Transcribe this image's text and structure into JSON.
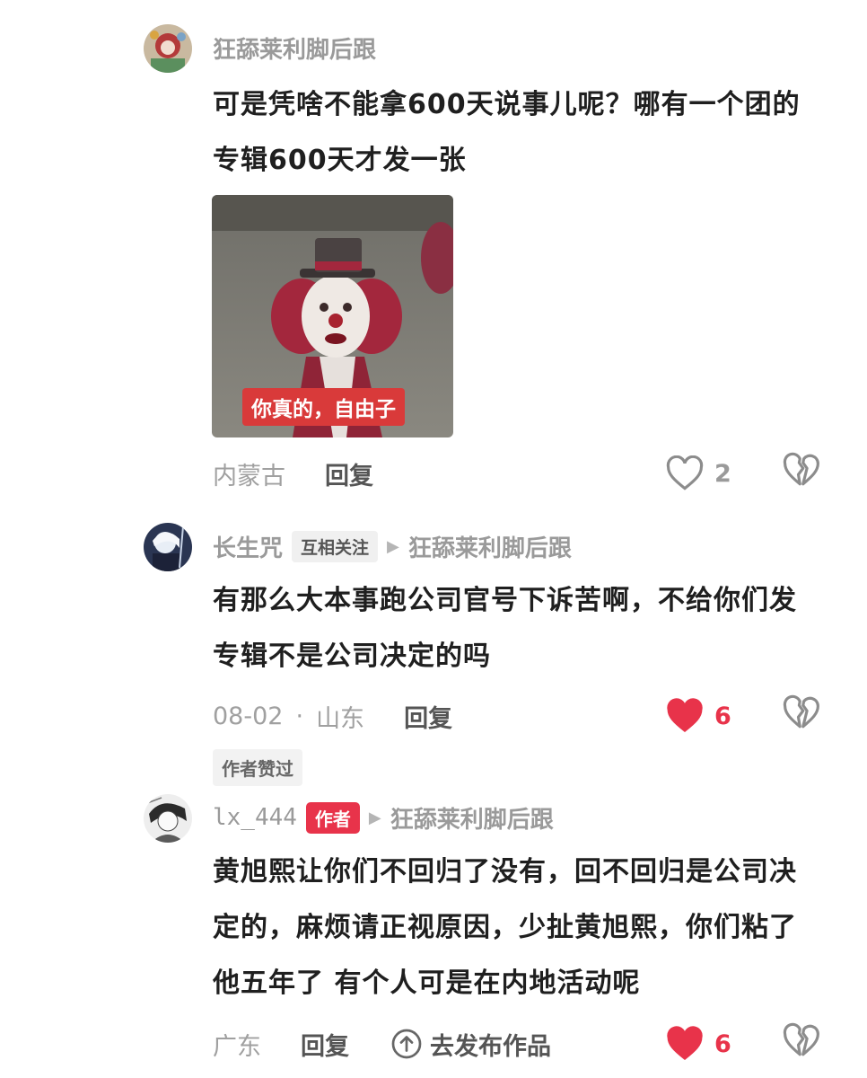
{
  "comments": [
    {
      "username": "狂舔莱利脚后跟",
      "text": "可是凭啥不能拿600天说事儿呢？哪有一个团的专辑600天才发一张",
      "sticker_caption": "你真的，自由子",
      "location": "内蒙古",
      "reply_label": "回复",
      "like_count": "2",
      "liked": false
    },
    {
      "username": "长生咒",
      "badge": "互相关注",
      "reply_to": "狂舔莱利脚后跟",
      "text": "有那么大本事跑公司官号下诉苦啊，不给你们发专辑不是公司决定的吗",
      "date": "08-02",
      "separator": "·",
      "location": "山东",
      "reply_label": "回复",
      "like_count": "6",
      "liked": true,
      "author_liked": "作者赞过"
    },
    {
      "username": "lx_444",
      "badge": "作者",
      "reply_to": "狂舔莱利脚后跟",
      "text": "黄旭熙让你们不回归了没有，回不回归是公司决定的，麻烦请正视原因，少扯黄旭熙，你们粘了他五年了  有个人可是在内地活动呢",
      "location": "广东",
      "reply_label": "回复",
      "publish_label": "去发布作品",
      "like_count": "6",
      "liked": true
    }
  ],
  "colors": {
    "accent_red": "#e8334a",
    "text_main": "#1f1f1f",
    "text_muted": "#9a9a9a"
  },
  "icons": {
    "like": "heart-icon",
    "dislike": "broken-heart-icon",
    "reply_arrow": "triangle-right-icon",
    "publish": "arrow-up-circle-icon"
  }
}
